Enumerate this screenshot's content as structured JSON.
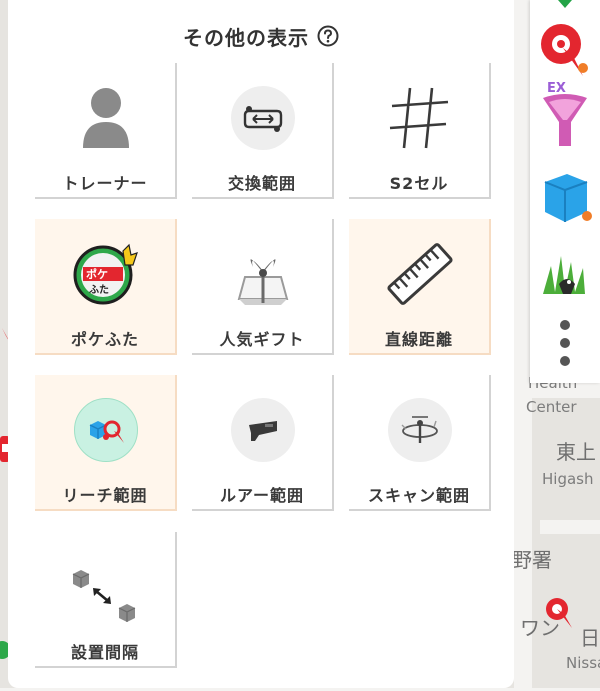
{
  "panel": {
    "title": "その他の表示",
    "help_icon": "question-circle-icon",
    "tiles": [
      {
        "label": "トレーナー",
        "icon": "trainer-silhouette-icon",
        "active": false
      },
      {
        "label": "交換範囲",
        "icon": "trade-range-icon",
        "active": false
      },
      {
        "label": "S2セル",
        "icon": "s2-cell-grid-icon",
        "active": false
      },
      {
        "label": "ポケふた",
        "icon": "pokefuta-manhole-icon",
        "active": true
      },
      {
        "label": "人気ギフト",
        "icon": "gift-icon",
        "active": false
      },
      {
        "label": "直線距離",
        "icon": "ruler-icon",
        "active": true
      },
      {
        "label": "リーチ範囲",
        "icon": "reach-range-icon",
        "active": true
      },
      {
        "label": "ルアー範囲",
        "icon": "lure-module-icon",
        "active": false
      },
      {
        "label": "スキャン範囲",
        "icon": "scan-range-icon",
        "active": false
      },
      {
        "label": "設置間隔",
        "icon": "placement-interval-icon",
        "active": false
      }
    ]
  },
  "rail": {
    "items": [
      {
        "icon": "pokestop-pin-icon"
      },
      {
        "icon": "raid-ex-icon",
        "badge": "EX"
      },
      {
        "icon": "cube-icon"
      },
      {
        "icon": "grass-pokemon-icon"
      },
      {
        "icon": "more-vertical-icon"
      }
    ]
  },
  "map": {
    "labels": [
      "Health",
      "Center",
      "東上",
      "Higash",
      "野署",
      "ワン",
      "日",
      "Nissa"
    ]
  },
  "colors": {
    "active_tile": "#fff6ec",
    "accent_orange": "#f07d28",
    "poke_red": "#e3262f",
    "cube_blue": "#2aa3e8",
    "raid_pink": "#d05bb4"
  }
}
